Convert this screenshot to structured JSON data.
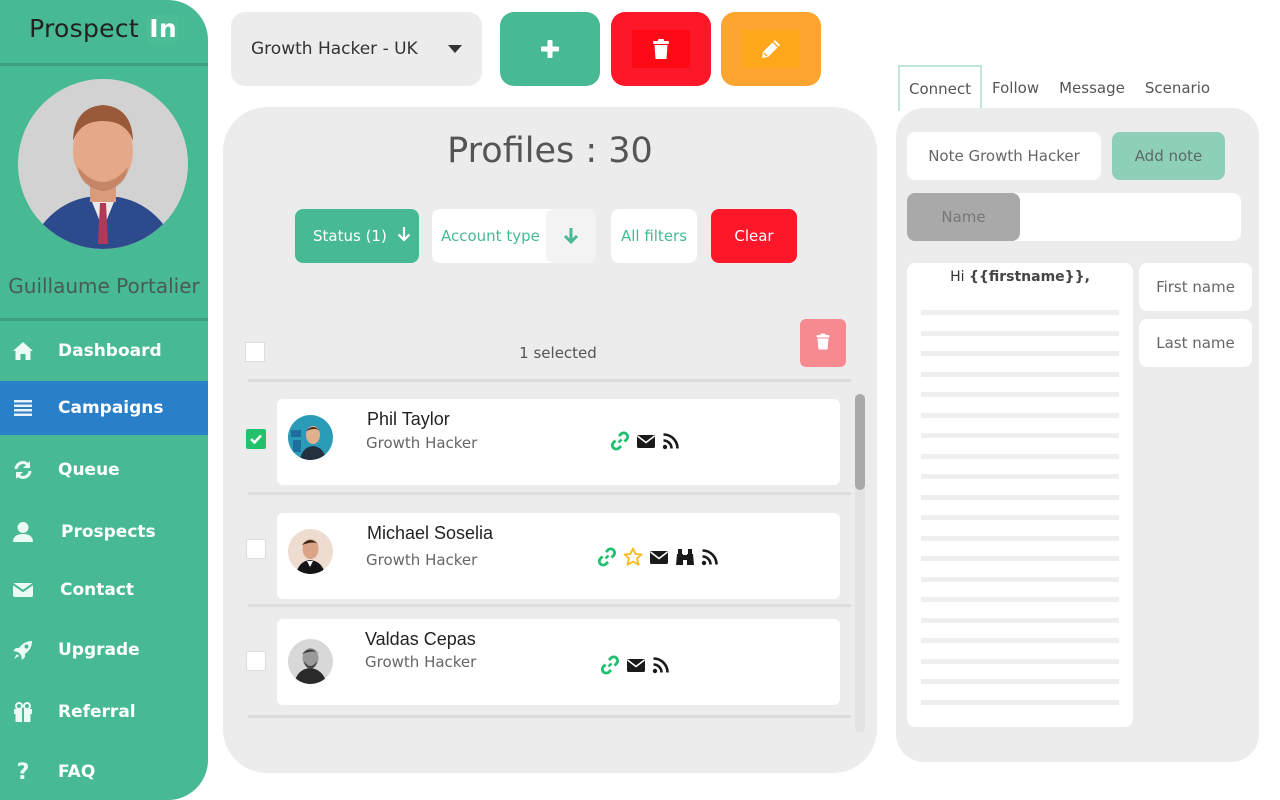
{
  "app": {
    "logo_text": "Prospect",
    "logo_badge": "In"
  },
  "user": {
    "name": "Guillaume Portalier",
    "avatar_icon": "user-photo"
  },
  "sidebar": {
    "items": [
      {
        "label": "Dashboard",
        "icon": "home-icon",
        "active": false
      },
      {
        "label": "Campaigns",
        "icon": "list-icon",
        "active": true
      },
      {
        "label": "Queue",
        "icon": "refresh-icon",
        "active": false
      },
      {
        "label": "Prospects",
        "icon": "user-icon",
        "active": false
      },
      {
        "label": "Contact",
        "icon": "envelope-icon",
        "active": false
      },
      {
        "label": "Upgrade",
        "icon": "rocket-icon",
        "active": false
      },
      {
        "label": "Referral",
        "icon": "gift-icon",
        "active": false
      },
      {
        "label": "FAQ",
        "icon": "question-icon",
        "active": false
      }
    ]
  },
  "toolbar": {
    "campaign_selected": "Growth Hacker - UK",
    "add_icon": "plus-icon",
    "delete_icon": "trash-icon",
    "edit_icon": "pencil-icon"
  },
  "colors": {
    "brand_green": "#47b994",
    "active_blue": "#2a7fc9",
    "danger_red": "#fd1728",
    "warning_orange": "#fda530",
    "link_green": "#1fbf70",
    "star_yellow": "#f9b81e"
  },
  "profiles": {
    "title": "Profiles : 30",
    "filters": {
      "status": "Status (1)",
      "account_type": "Account type",
      "all_filters": "All filters",
      "clear": "Clear"
    },
    "selection_text": "1 selected",
    "rows": [
      {
        "name": "Phil Taylor",
        "title": "Growth Hacker",
        "checked": true,
        "icons": [
          "link-icon",
          "envelope-icon",
          "rss-icon"
        ]
      },
      {
        "name": "Michael Soselia",
        "title": "Growth Hacker",
        "checked": false,
        "icons": [
          "link-icon",
          "star-icon",
          "envelope-icon",
          "binoculars-icon",
          "rss-icon"
        ]
      },
      {
        "name": "Valdas Cepas",
        "title": "Growth Hacker",
        "checked": false,
        "icons": [
          "link-icon",
          "envelope-icon",
          "rss-icon"
        ]
      }
    ]
  },
  "right_panel": {
    "tabs": [
      {
        "label": "Connect",
        "active": true
      },
      {
        "label": "Follow",
        "active": false
      },
      {
        "label": "Message",
        "active": false
      },
      {
        "label": "Scenario",
        "active": false
      }
    ],
    "note_value": "Note Growth Hacker",
    "add_note_label": "Add note",
    "name_chip": "Name",
    "message_greeting_prefix": "Hi ",
    "message_greeting_var": "{{firstname}},",
    "variables": [
      "First name",
      "Last name"
    ]
  }
}
